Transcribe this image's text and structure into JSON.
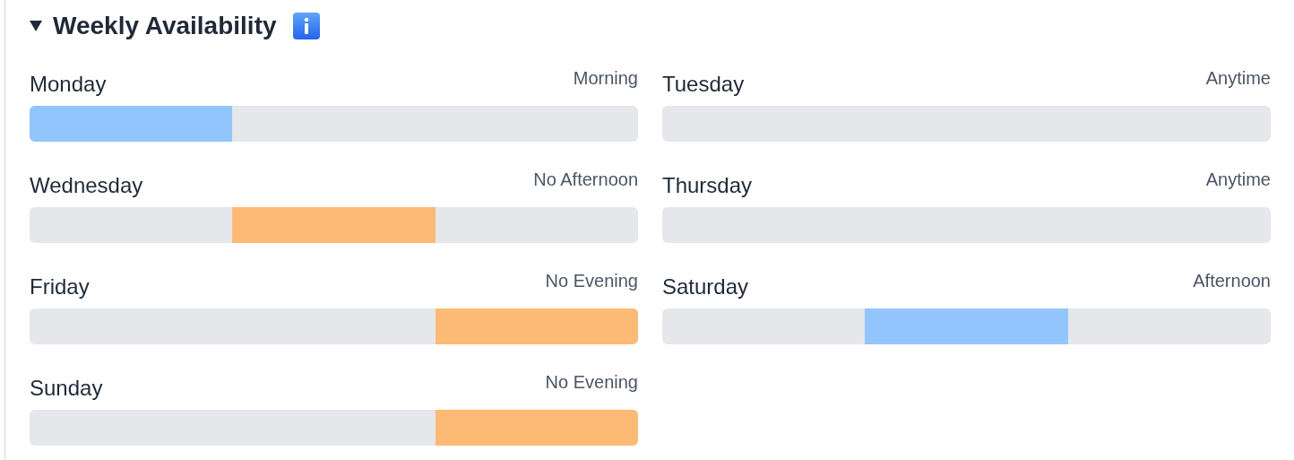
{
  "section": {
    "title": "Weekly Availability",
    "expanded": true
  },
  "days": [
    {
      "name": "Monday",
      "status": "Morning",
      "slots": [
        {
          "kind": "available"
        },
        {
          "kind": "open"
        },
        {
          "kind": "open"
        }
      ]
    },
    {
      "name": "Tuesday",
      "status": "Anytime",
      "slots": [
        {
          "kind": "open"
        },
        {
          "kind": "open"
        },
        {
          "kind": "open"
        }
      ]
    },
    {
      "name": "Wednesday",
      "status": "No Afternoon",
      "slots": [
        {
          "kind": "open"
        },
        {
          "kind": "unavailable"
        },
        {
          "kind": "open"
        }
      ]
    },
    {
      "name": "Thursday",
      "status": "Anytime",
      "slots": [
        {
          "kind": "open"
        },
        {
          "kind": "open"
        },
        {
          "kind": "open"
        }
      ]
    },
    {
      "name": "Friday",
      "status": "No Evening",
      "slots": [
        {
          "kind": "open"
        },
        {
          "kind": "open"
        },
        {
          "kind": "unavailable"
        }
      ]
    },
    {
      "name": "Saturday",
      "status": "Afternoon",
      "slots": [
        {
          "kind": "open"
        },
        {
          "kind": "available"
        },
        {
          "kind": "open"
        }
      ]
    },
    {
      "name": "Sunday",
      "status": "No Evening",
      "slots": [
        {
          "kind": "open"
        },
        {
          "kind": "open"
        },
        {
          "kind": "unavailable"
        }
      ]
    }
  ]
}
